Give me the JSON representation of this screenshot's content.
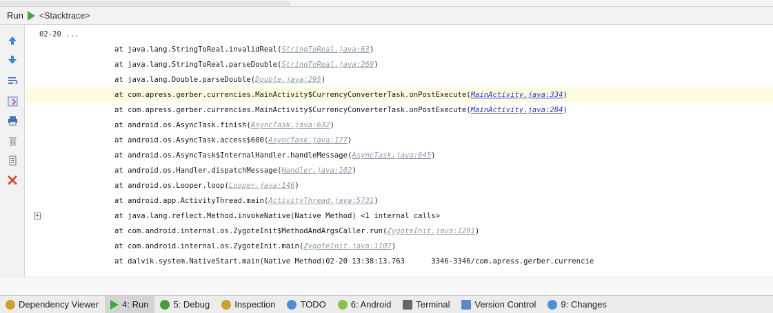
{
  "header": {
    "run_label": "Run",
    "tab_name": "<Stacktrace>"
  },
  "toolbar_icons": [
    "up-arrow-icon",
    "down-arrow-icon",
    "soft-wrap-icon",
    "scroll-to-end-icon",
    "print-icon",
    "clear-all-icon",
    "settings-icon",
    "close-icon"
  ],
  "console": {
    "header_line": "02-20 ...",
    "lines": [
      {
        "pre": "at java.lang.StringToReal.invalidReal(",
        "link": "StringToReal.java:63",
        "post": ")"
      },
      {
        "pre": "at java.lang.StringToReal.parseDouble(",
        "link": "StringToReal.java:269",
        "post": ")"
      },
      {
        "pre": "at java.lang.Double.parseDouble(",
        "link": "Double.java:295",
        "post": ")"
      },
      {
        "pre": "at com.apress.gerber.currencies.MainActivity$CurrencyConverterTask.onPostExecute(",
        "link": "MainActivity.java:334",
        "post": ")"
      },
      {
        "pre": "at com.apress.gerber.currencies.MainActivity$CurrencyConverterTask.onPostExecute(",
        "link": "MainActivity.java:284",
        "post": ")"
      },
      {
        "pre": "at android.os.AsyncTask.finish(",
        "link": "AsyncTask.java:632",
        "post": ")"
      },
      {
        "pre": "at android.os.AsyncTask.access$600(",
        "link": "AsyncTask.java:177",
        "post": ")"
      },
      {
        "pre": "at android.os.AsyncTask$InternalHandler.handleMessage(",
        "link": "AsyncTask.java:645",
        "post": ")"
      },
      {
        "pre": "at android.os.Handler.dispatchMessage(",
        "link": "Handler.java:102",
        "post": ")"
      },
      {
        "pre": "at android.os.Looper.loop(",
        "link": "Looper.java:146",
        "post": ")"
      },
      {
        "pre": "at android.app.ActivityThread.main(",
        "link": "ActivityThread.java:5731",
        "post": ")"
      },
      {
        "pre": "at java.lang.reflect.Method.invokeNative(Native Method) <1 internal calls>",
        "link": "",
        "post": ""
      },
      {
        "pre": "at com.android.internal.os.ZygoteInit$MethodAndArgsCaller.run(",
        "link": "ZygoteInit.java:1291",
        "post": ")"
      },
      {
        "pre": "at com.android.internal.os.ZygoteInit.main(",
        "link": "ZygoteInit.java:1107",
        "post": ")"
      },
      {
        "pre": "at dalvik.system.NativeStart.main(Native Method)02-20 13:38:13.763      3346-3346/com.apress.gerber.currencie",
        "link": "",
        "post": ""
      }
    ],
    "highlighted_line": 3,
    "blue_link_lines": [
      3,
      4
    ],
    "expand_marker": "+"
  },
  "bottom_tabs": [
    {
      "label": "Dependency Viewer",
      "icon": "dependency-icon",
      "color": "#c9a227"
    },
    {
      "label": "4: Run",
      "icon": "run-icon",
      "color": "#3fa83f",
      "active": true
    },
    {
      "label": "5: Debug",
      "icon": "debug-icon",
      "color": "#4c9a3a"
    },
    {
      "label": "Inspection",
      "icon": "inspection-icon",
      "color": "#c9a227"
    },
    {
      "label": "TODO",
      "icon": "todo-icon",
      "color": "#4a8fd8"
    },
    {
      "label": "6: Android",
      "icon": "android-icon",
      "color": "#8bc34a"
    },
    {
      "label": "Terminal",
      "icon": "terminal-icon",
      "color": "#666666"
    },
    {
      "label": "Version Control",
      "icon": "version-control-icon",
      "color": "#5b8bc7"
    },
    {
      "label": "9: Changes",
      "icon": "changes-icon",
      "color": "#4a8fd8"
    }
  ],
  "colors": {
    "link_gray": "#8e9aa8",
    "link_blue": "#2a38c8",
    "highlight": "#fdfbe0",
    "run_green": "#3fa83f"
  }
}
